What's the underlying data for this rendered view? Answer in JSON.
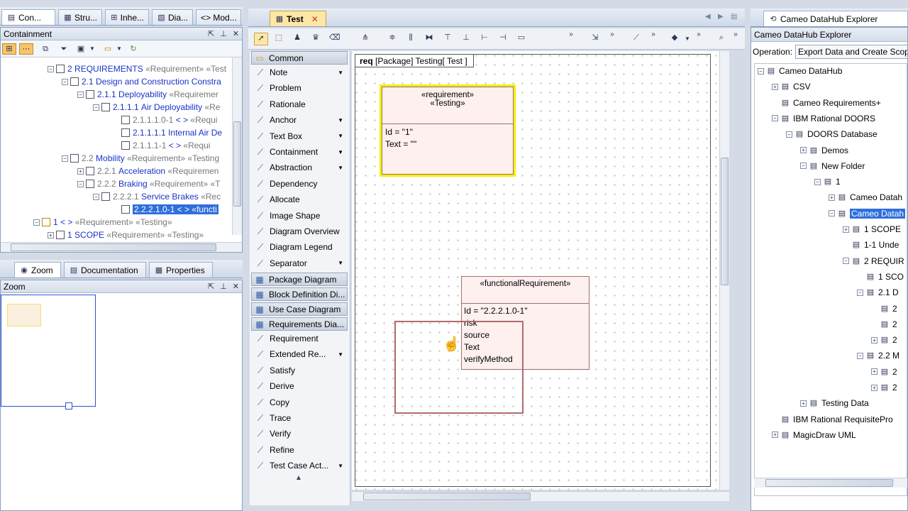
{
  "top_tabs": [
    {
      "label": "Con..."
    },
    {
      "label": "Stru..."
    },
    {
      "label": "Inhe..."
    },
    {
      "label": "Dia..."
    },
    {
      "label": "<> Mod..."
    }
  ],
  "containment": {
    "title": "Containment",
    "tree": [
      {
        "num": "2",
        "name": "REQUIREMENTS",
        "stereo": "«Requirement» «Test"
      },
      {
        "num": "2.1",
        "name": "Design and Construction Constra",
        "stereo": ""
      },
      {
        "num": "2.1.1",
        "name": "Deployability",
        "stereo": "«Requiremer"
      },
      {
        "num": "2.1.1.1",
        "name": "Air Deployability",
        "stereo": "«Re"
      },
      {
        "num": "2.1.1.1.0-1",
        "name": "< >",
        "stereo": "«Requi"
      },
      {
        "num": "2.1.1.1.1",
        "name": "Internal Air De",
        "stereo": ""
      },
      {
        "num": "2.1.1.1-1",
        "name": "< >",
        "stereo": "«Requi"
      },
      {
        "num": "2.2",
        "name": "Mobility",
        "stereo": "«Requirement» «Testing"
      },
      {
        "num": "2.2.1",
        "name": "Acceleration",
        "stereo": "«Requiremen"
      },
      {
        "num": "2.2.2",
        "name": "Braking",
        "stereo": "«Requirement» «T"
      },
      {
        "num": "2.2.2.1",
        "name": "Service Brakes",
        "stereo": "«Rec"
      },
      {
        "num": "2.2.2.1.0-1",
        "name": "< >",
        "stereo": "«functi"
      },
      {
        "num": "1",
        "name": "< >",
        "stereo": "«Requirement» «Testing»"
      },
      {
        "num": "1",
        "name": "SCOPE",
        "stereo": "«Requirement» «Testing»"
      }
    ]
  },
  "lower_tabs": [
    {
      "label": "Zoom"
    },
    {
      "label": "Documentation"
    },
    {
      "label": "Properties"
    }
  ],
  "zoom_panel": {
    "title": "Zoom"
  },
  "diagram_tab": {
    "label": "Test"
  },
  "palette": {
    "common_group": "Common",
    "items": [
      {
        "label": "Note",
        "arrow": true
      },
      {
        "label": "Problem",
        "arrow": false
      },
      {
        "label": "Rationale",
        "arrow": false
      },
      {
        "label": "Anchor",
        "arrow": true
      },
      {
        "label": "Text Box",
        "arrow": true
      },
      {
        "label": "Containment",
        "arrow": true
      },
      {
        "label": "Abstraction",
        "arrow": true
      },
      {
        "label": "Dependency",
        "arrow": false
      },
      {
        "label": "Allocate",
        "arrow": false
      },
      {
        "label": "Image Shape",
        "arrow": false
      },
      {
        "label": "Diagram Overview",
        "arrow": false
      },
      {
        "label": "Diagram Legend",
        "arrow": false
      },
      {
        "label": "Separator",
        "arrow": true
      }
    ],
    "groups": [
      "Package Diagram",
      "Block Definition Di...",
      "Use Case Diagram",
      "Requirements Dia..."
    ],
    "req_items": [
      {
        "label": "Requirement",
        "arrow": false
      },
      {
        "label": "Extended Re...",
        "arrow": true
      },
      {
        "label": "Satisfy",
        "arrow": false
      },
      {
        "label": "Derive",
        "arrow": false
      },
      {
        "label": "Copy",
        "arrow": false
      },
      {
        "label": "Trace",
        "arrow": false
      },
      {
        "label": "Verify",
        "arrow": false
      },
      {
        "label": "Refine",
        "arrow": false
      },
      {
        "label": "Test Case Act...",
        "arrow": true
      }
    ]
  },
  "diagram": {
    "frame_kind": "req",
    "frame_label": "[Package] Testing[ Test ]",
    "req1": {
      "stereo1": "«requirement»",
      "stereo2": "«Testing»",
      "id": "Id = \"1\"",
      "text": "Text = \"\""
    },
    "req2": {
      "stereo": "«functionalRequirement»",
      "id": "Id = \"2.2.2.1.0-1\"",
      "attrs": [
        "risk",
        "source",
        "Text",
        "verifyMethod"
      ]
    }
  },
  "explorer": {
    "tab_label": "Cameo DataHub Explorer",
    "title": "Cameo DataHub Explorer",
    "operation_label": "Operation:",
    "operation_value": "Export Data and Create Scop",
    "tree": [
      "Cameo DataHub",
      "CSV",
      "Cameo Requirements+",
      "IBM Rational DOORS",
      "DOORS Database",
      "Demos",
      "New Folder",
      "1",
      "Cameo Datah",
      "Cameo Datah",
      "1 SCOPE",
      "1-1 Unde",
      "2 REQUIR",
      "1 SCO",
      "2.1 D",
      "2",
      "2",
      "2",
      "2.2 M",
      "2",
      "2",
      "Testing Data",
      "IBM Rational RequisitePro",
      "MagicDraw UML"
    ]
  },
  "colors": {
    "selection": "#2f6fdc",
    "link_blue": "#1a33c7",
    "req_fill": "#fdf0ef",
    "req_highlight": "#f3f000"
  }
}
